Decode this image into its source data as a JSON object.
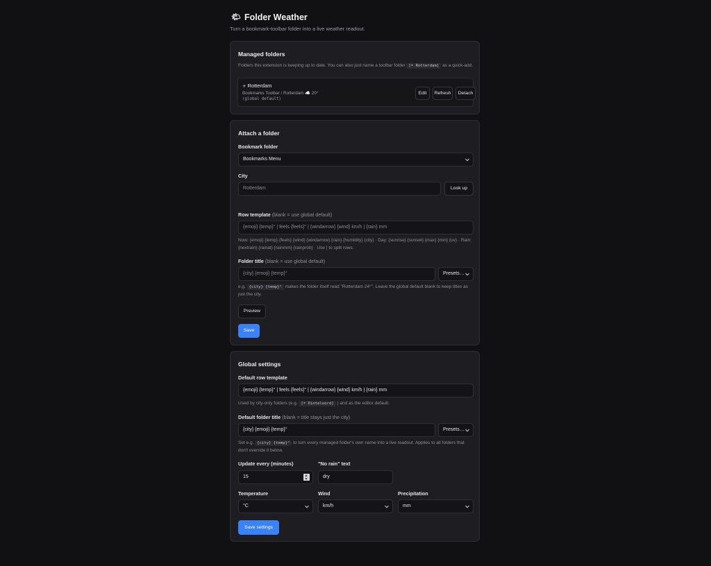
{
  "app": {
    "logo_icon": "sun-behind-cloud-icon",
    "logo_glyph": "🌤",
    "title": "Folder Weather",
    "subtitle": "Turn a bookmark-toolbar folder into a live weather readout."
  },
  "managed": {
    "title": "Managed folders",
    "help_before": "Folders this extension is keeping up to date. You can also just name a toolbar folder",
    "help_code": "[☀ Rotterdam]",
    "help_after": "as a quick-add.",
    "folders": [
      {
        "name": "Rotterdam",
        "path": "Bookmarks Toolbar / Rotterdam ☁️ 20°",
        "template": "(global default)",
        "edit_label": "Edit",
        "refresh_label": "Refresh",
        "detach_label": "Detach"
      }
    ]
  },
  "attach": {
    "title": "Attach a folder",
    "folder_label": "Bookmark folder",
    "folder_value": "Bookmarks Menu",
    "city_label": "City",
    "city_placeholder": "Rotterdam",
    "lookup_label": "Look up",
    "row_template_label": "Row template",
    "row_template_hint": "(blank = use global default)",
    "row_template_placeholder": "{emoji} {temp}° | feels {feels}° | {windarrow} {wind} km/h | {rain} mm",
    "row_template_help": "Now: {emoji} {temp} {feels} {wind} {windarrow} {rain} {humidity} {city} · Day: {sunrise} {sunset} {max} {min} {uv} · Rain: {nextrain} {rainat} {rainmm} {rainprob} · Use | to split rows.",
    "folder_title_label": "Folder title",
    "folder_title_hint": "(blank = use global default)",
    "folder_title_placeholder": "{city} {emoji} {temp}°",
    "presets_label": "Presets…",
    "folder_title_help_before": "e.g.",
    "folder_title_help_code": "{city} {temp}°",
    "folder_title_help_after": "makes the folder itself read \"Rotterdam 24°\". Leave the global default blank to keep titles as just the city.",
    "preview_label": "Preview",
    "save_label": "Save"
  },
  "global": {
    "title": "Global settings",
    "default_row_label": "Default row template",
    "default_row_value": "{emoji} {temp}° | feels {feels}° | {windarrow} {wind} km/h | {rain} mm",
    "default_row_help_before": "Used by city-only folders (e.g.",
    "default_row_help_code": "[☀ Dinteloord]",
    "default_row_help_after": ") and as the editor default.",
    "default_title_label": "Default folder title",
    "default_title_hint": "(blank = title stays just the city)",
    "default_title_value": "{city} {emoji} {temp}°",
    "presets_label": "Presets…",
    "default_title_help_before": "Set e.g.",
    "default_title_help_code": "{city} {temp}°",
    "default_title_help_after": "to turn every managed folder's own name into a live readout. Applies to all folders that don't override it below.",
    "update_label": "Update every (minutes)",
    "update_value": "15",
    "norain_label": "\"No rain\" text",
    "norain_value": "dry",
    "temperature_label": "Temperature",
    "temperature_value": "°C",
    "wind_label": "Wind",
    "wind_value": "km/h",
    "precip_label": "Precipitation",
    "precip_value": "mm",
    "save_label": "Save settings"
  }
}
